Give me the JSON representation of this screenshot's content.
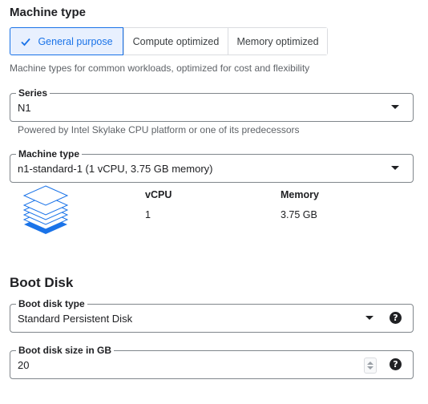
{
  "machine_type_section": {
    "title": "Machine type",
    "tabs": [
      {
        "label": "General purpose",
        "selected": true
      },
      {
        "label": "Compute optimized",
        "selected": false
      },
      {
        "label": "Memory optimized",
        "selected": false
      }
    ],
    "description": "Machine types for common workloads, optimized for cost and flexibility"
  },
  "series": {
    "label": "Series",
    "value": "N1",
    "helper": "Powered by Intel Skylake CPU platform or one of its predecessors"
  },
  "machine_type": {
    "label": "Machine type",
    "value": "n1-standard-1 (1 vCPU, 3.75 GB memory)"
  },
  "specs": {
    "vcpu_header": "vCPU",
    "memory_header": "Memory",
    "vcpu_value": "1",
    "memory_value": "3.75 GB"
  },
  "boot_disk": {
    "title": "Boot Disk",
    "type_label": "Boot disk type",
    "type_value": "Standard Persistent Disk",
    "size_label": "Boot disk size in GB",
    "size_value": "20",
    "help_glyph": "?"
  },
  "colors": {
    "accent": "#1a73e8",
    "accent_bg": "#e8f0fe",
    "border": "#80868b",
    "helper_text": "#5f6368"
  },
  "icons": {
    "check": "check-icon",
    "dropdown": "dropdown-caret-icon",
    "help": "help-icon",
    "machine_stack": "machine-stack-icon"
  }
}
